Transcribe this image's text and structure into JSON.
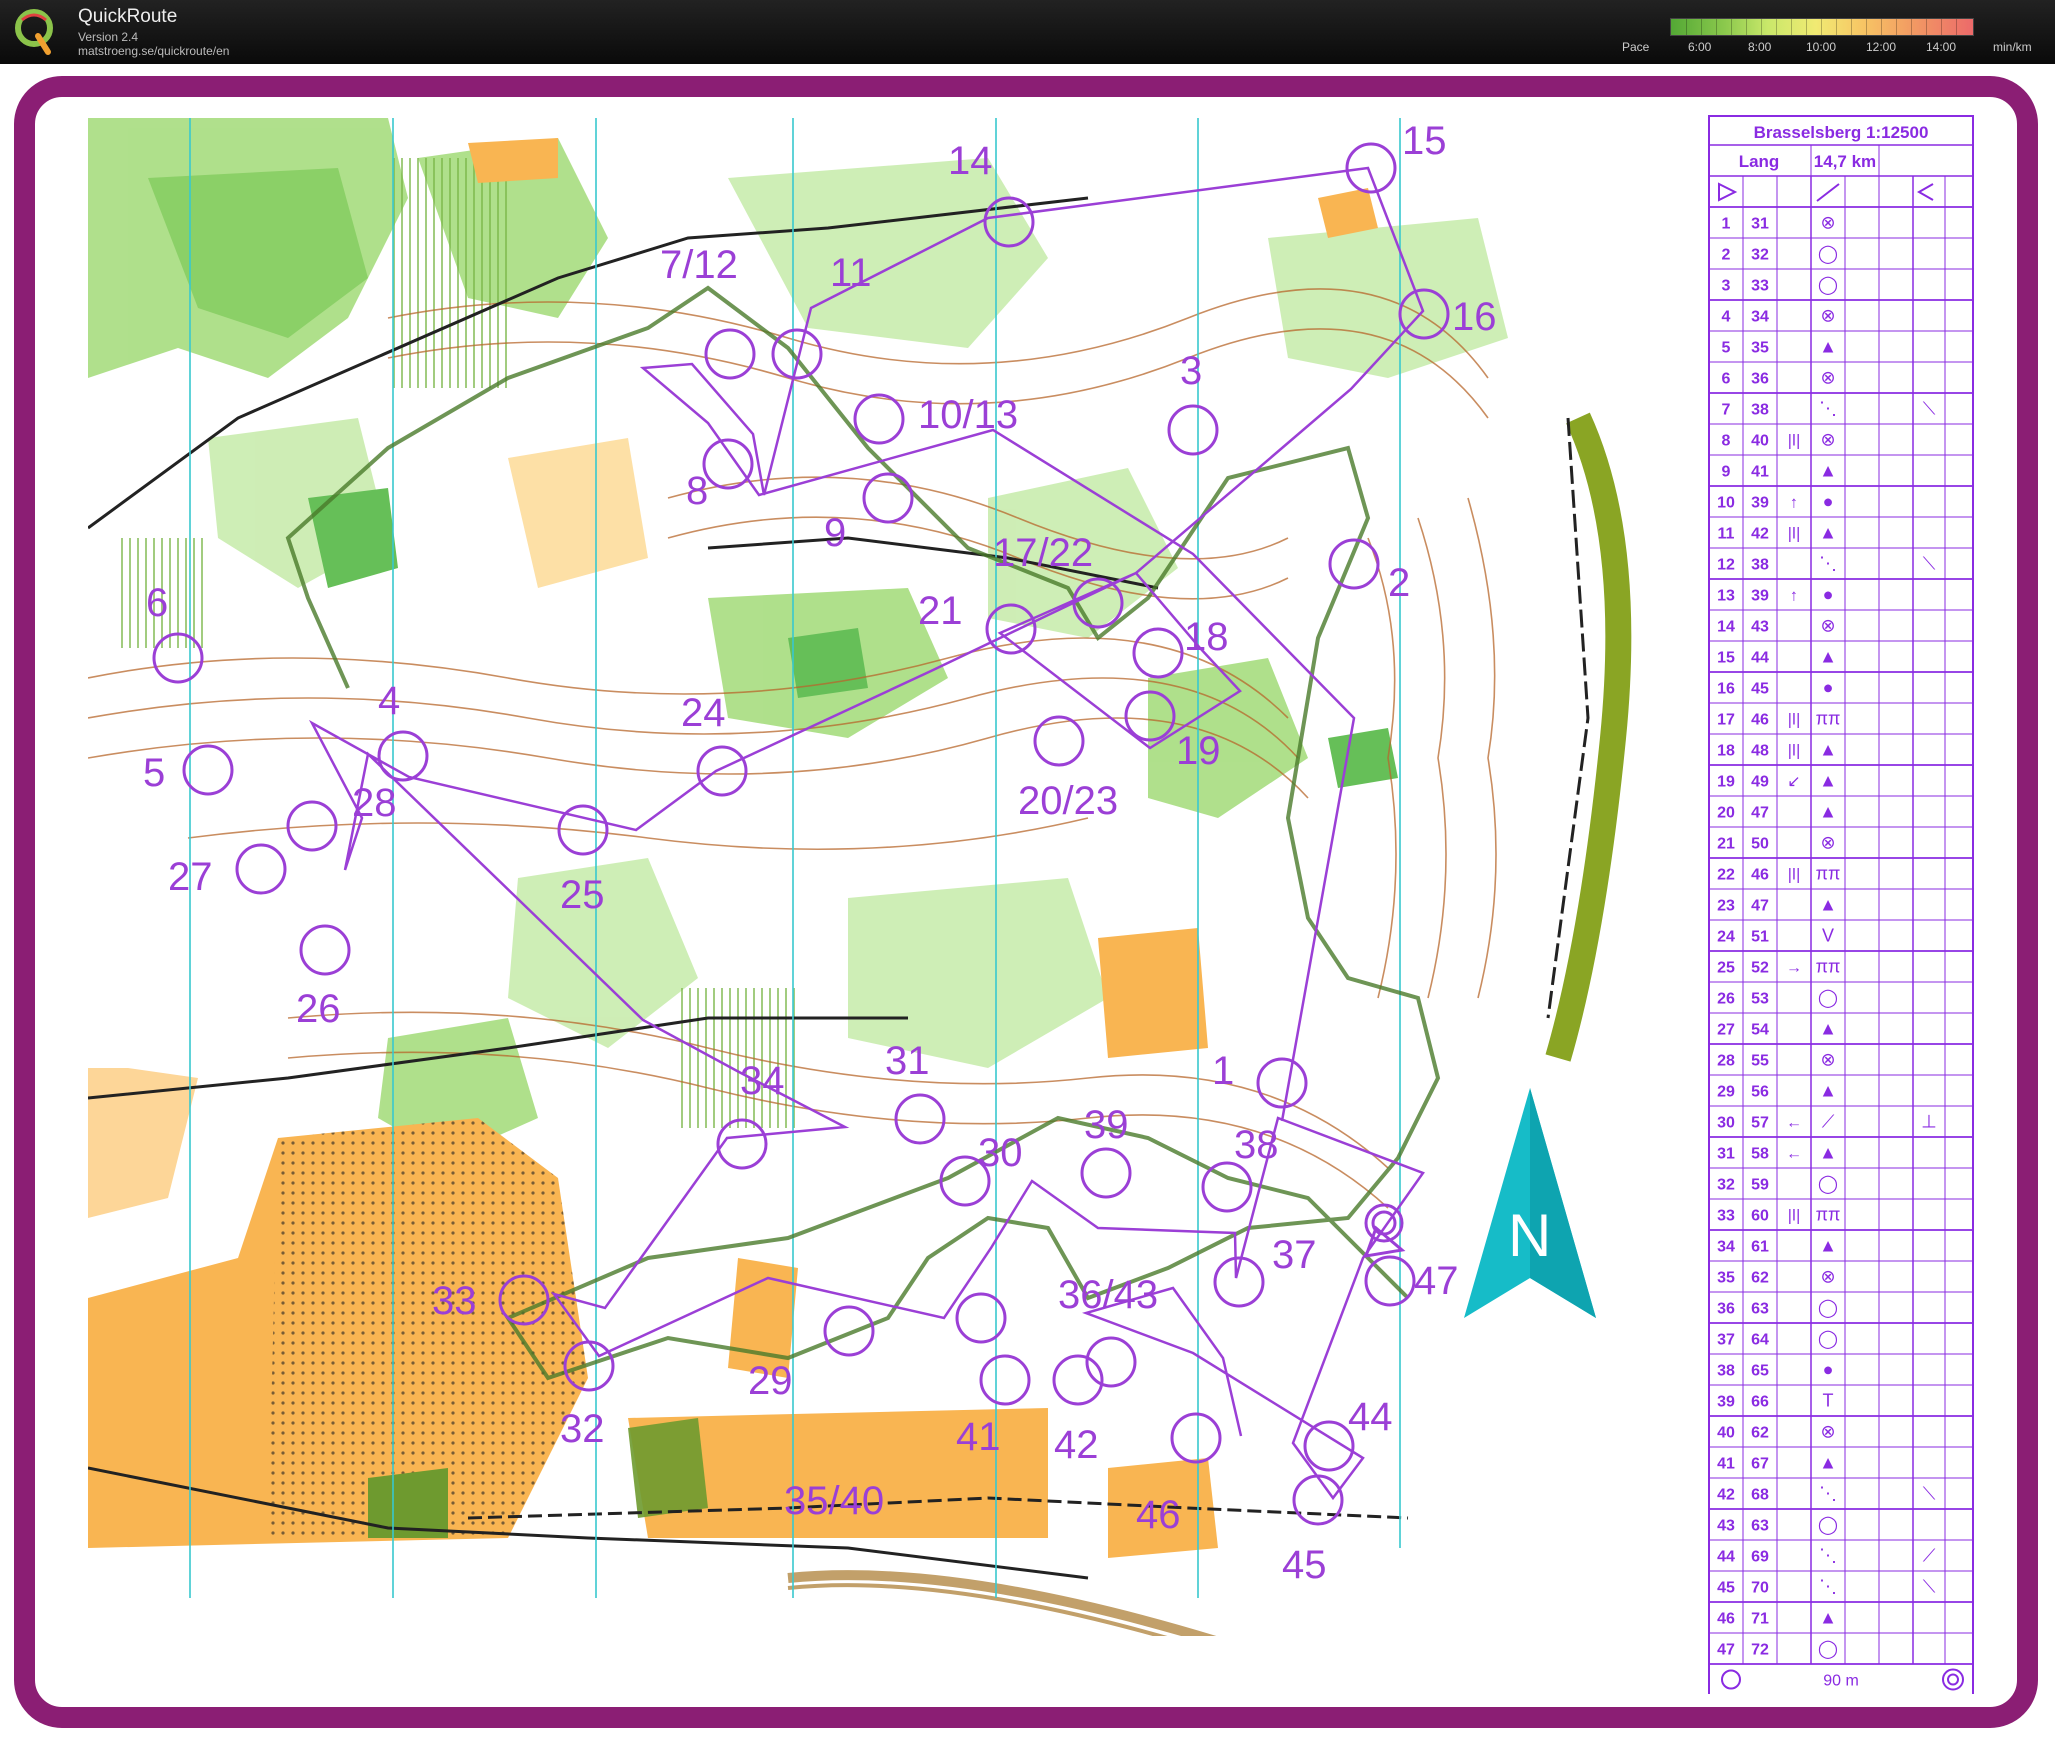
{
  "app": {
    "name": "QuickRoute",
    "version": "Version 2.4",
    "url": "matstroeng.se/quickroute/en"
  },
  "pace": {
    "label": "Pace",
    "ticks": [
      "6:00",
      "8:00",
      "10:00",
      "12:00",
      "14:00"
    ],
    "unit": "min/km"
  },
  "colors": {
    "frame": "#8b1e74",
    "course": "#9b3fd6",
    "north_arrow": "#16bcc8"
  },
  "north_arrow": {
    "label": "N"
  },
  "map": {
    "controls": [
      "1",
      "2",
      "3",
      "4",
      "5",
      "6",
      "7/12",
      "8",
      "9",
      "10/13",
      "11",
      "14",
      "15",
      "16",
      "17/22",
      "18",
      "19",
      "20/23",
      "21",
      "24",
      "25",
      "26",
      "27",
      "28",
      "29",
      "30",
      "31",
      "32",
      "33",
      "34",
      "35/40",
      "36/43",
      "37",
      "38",
      "39",
      "41",
      "42",
      "44",
      "45",
      "46",
      "47"
    ]
  },
  "legend": {
    "title": "Brasselsberg 1:12500",
    "class": "Lang",
    "length": "14,7 km",
    "finish_distance": "90 m",
    "rows": [
      {
        "n": "1",
        "code": "31",
        "c": "",
        "d": "⊗",
        "g": ""
      },
      {
        "n": "2",
        "code": "32",
        "c": "",
        "d": "◯",
        "g": ""
      },
      {
        "n": "3",
        "code": "33",
        "c": "",
        "d": "◯",
        "g": ""
      },
      {
        "n": "4",
        "code": "34",
        "c": "",
        "d": "⊗",
        "g": ""
      },
      {
        "n": "5",
        "code": "35",
        "c": "",
        "d": "▲",
        "g": ""
      },
      {
        "n": "6",
        "code": "36",
        "c": "",
        "d": "⊗",
        "g": ""
      },
      {
        "n": "7",
        "code": "38",
        "c": "",
        "d": "⋱",
        "g": "⟍"
      },
      {
        "n": "8",
        "code": "40",
        "c": "|ǀ|",
        "d": "⊗",
        "g": ""
      },
      {
        "n": "9",
        "code": "41",
        "c": "",
        "d": "▲",
        "g": ""
      },
      {
        "n": "10",
        "code": "39",
        "c": "↑",
        "d": "●",
        "g": ""
      },
      {
        "n": "11",
        "code": "42",
        "c": "|ǀ|",
        "d": "▲",
        "g": ""
      },
      {
        "n": "12",
        "code": "38",
        "c": "",
        "d": "⋱",
        "g": "⟍"
      },
      {
        "n": "13",
        "code": "39",
        "c": "↑",
        "d": "●",
        "g": ""
      },
      {
        "n": "14",
        "code": "43",
        "c": "",
        "d": "⊗",
        "g": ""
      },
      {
        "n": "15",
        "code": "44",
        "c": "",
        "d": "▲",
        "g": ""
      },
      {
        "n": "16",
        "code": "45",
        "c": "",
        "d": "●",
        "g": ""
      },
      {
        "n": "17",
        "code": "46",
        "c": "|ǀ|",
        "d": "ππ",
        "g": ""
      },
      {
        "n": "18",
        "code": "48",
        "c": "|ǀ|",
        "d": "▲",
        "g": ""
      },
      {
        "n": "19",
        "code": "49",
        "c": "↙",
        "d": "▲",
        "g": ""
      },
      {
        "n": "20",
        "code": "47",
        "c": "",
        "d": "▲",
        "g": ""
      },
      {
        "n": "21",
        "code": "50",
        "c": "",
        "d": "⊗",
        "g": ""
      },
      {
        "n": "22",
        "code": "46",
        "c": "|ǀ|",
        "d": "ππ",
        "g": ""
      },
      {
        "n": "23",
        "code": "47",
        "c": "",
        "d": "▲",
        "g": ""
      },
      {
        "n": "24",
        "code": "51",
        "c": "",
        "d": "V",
        "g": ""
      },
      {
        "n": "25",
        "code": "52",
        "c": "→",
        "d": "ππ",
        "g": ""
      },
      {
        "n": "26",
        "code": "53",
        "c": "",
        "d": "◯",
        "g": ""
      },
      {
        "n": "27",
        "code": "54",
        "c": "",
        "d": "▲",
        "g": ""
      },
      {
        "n": "28",
        "code": "55",
        "c": "",
        "d": "⊗",
        "g": ""
      },
      {
        "n": "29",
        "code": "56",
        "c": "",
        "d": "▲",
        "g": ""
      },
      {
        "n": "30",
        "code": "57",
        "c": "←",
        "d": "⟋",
        "g": "⊥"
      },
      {
        "n": "31",
        "code": "58",
        "c": "←",
        "d": "▲",
        "g": ""
      },
      {
        "n": "32",
        "code": "59",
        "c": "",
        "d": "◯",
        "g": ""
      },
      {
        "n": "33",
        "code": "60",
        "c": "|ǀ|",
        "d": "ππ",
        "g": ""
      },
      {
        "n": "34",
        "code": "61",
        "c": "",
        "d": "▲",
        "g": ""
      },
      {
        "n": "35",
        "code": "62",
        "c": "",
        "d": "⊗",
        "g": ""
      },
      {
        "n": "36",
        "code": "63",
        "c": "",
        "d": "◯",
        "g": ""
      },
      {
        "n": "37",
        "code": "64",
        "c": "",
        "d": "◯",
        "g": ""
      },
      {
        "n": "38",
        "code": "65",
        "c": "",
        "d": "●",
        "g": ""
      },
      {
        "n": "39",
        "code": "66",
        "c": "",
        "d": "T",
        "g": ""
      },
      {
        "n": "40",
        "code": "62",
        "c": "",
        "d": "⊗",
        "g": ""
      },
      {
        "n": "41",
        "code": "67",
        "c": "",
        "d": "▲",
        "g": ""
      },
      {
        "n": "42",
        "code": "68",
        "c": "",
        "d": "⋱",
        "g": "⟍"
      },
      {
        "n": "43",
        "code": "63",
        "c": "",
        "d": "◯",
        "g": ""
      },
      {
        "n": "44",
        "code": "69",
        "c": "",
        "d": "⋱",
        "g": "⟋"
      },
      {
        "n": "45",
        "code": "70",
        "c": "",
        "d": "⋱",
        "g": "⟍"
      },
      {
        "n": "46",
        "code": "71",
        "c": "",
        "d": "▲",
        "g": ""
      },
      {
        "n": "47",
        "code": "72",
        "c": "",
        "d": "◯",
        "g": ""
      }
    ]
  }
}
